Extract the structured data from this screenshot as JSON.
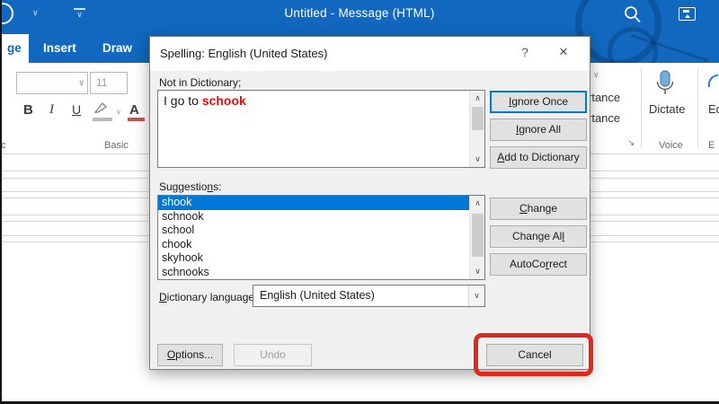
{
  "titlebar": {
    "title": "Untitled - Message (HTML)"
  },
  "tabs": {
    "active_fragment": "ge",
    "insert": "Insert",
    "draw": "Draw"
  },
  "ribbon": {
    "font_size": "11",
    "bold_label": "B",
    "italic_label": "I",
    "underline_label": "U",
    "basic_group_fragment": "Basic",
    "clipboard_group_fragment": "c",
    "importance_fragment_high": "rtance",
    "importance_fragment_low": "rtance",
    "dialog_launcher_icon": "↘",
    "dictate_label": "Dictate",
    "voice_group_label": "Voice",
    "editor_label_fragment": "Ed",
    "editor_group_fragment": "E"
  },
  "glyphs": {
    "chevron_down": "∨",
    "scroll_up": "∧",
    "scroll_down": "∨"
  },
  "dialog": {
    "title": "Spelling: English (United States)",
    "help_button": "?",
    "close_button": "×",
    "not_in_dictionary_label": "Not in Dictionary;",
    "sentence_prefix": "I go to ",
    "misspelled_word": "schook",
    "suggestions_label": {
      "text": "Suggestions:",
      "ak": 9
    },
    "suggestions": [
      "shook",
      "schnook",
      "school",
      "chook",
      "skyhook",
      "schnooks"
    ],
    "selected_suggestion": "shook",
    "dictionary_language_label": {
      "text": "Dictionary language:",
      "ak": 0
    },
    "dictionary_language_value": "English (United States)",
    "buttons": {
      "ignore_once": {
        "text": "Ignore Once",
        "ak": 0
      },
      "ignore_all": {
        "text": "Ignore All",
        "ak": 0
      },
      "add_to_dictionary": {
        "text": "Add to Dictionary",
        "ak": 0
      },
      "change": {
        "text": "Change",
        "ak": 0
      },
      "change_all": {
        "text": "Change All",
        "ak": 9
      },
      "autocorrect": {
        "text": "AutoCorrect",
        "ak": 6
      },
      "options": {
        "text": "Options...",
        "ak": 0
      },
      "undo": {
        "text": "Undo",
        "ak": -1
      },
      "cancel": {
        "text": "Cancel",
        "ak": -1
      }
    }
  },
  "colors": {
    "titlebar_blue": "#1168be",
    "selection_blue": "#0078d7",
    "misspelled_red": "#e01010",
    "annotation_red": "#dc2b1c"
  }
}
